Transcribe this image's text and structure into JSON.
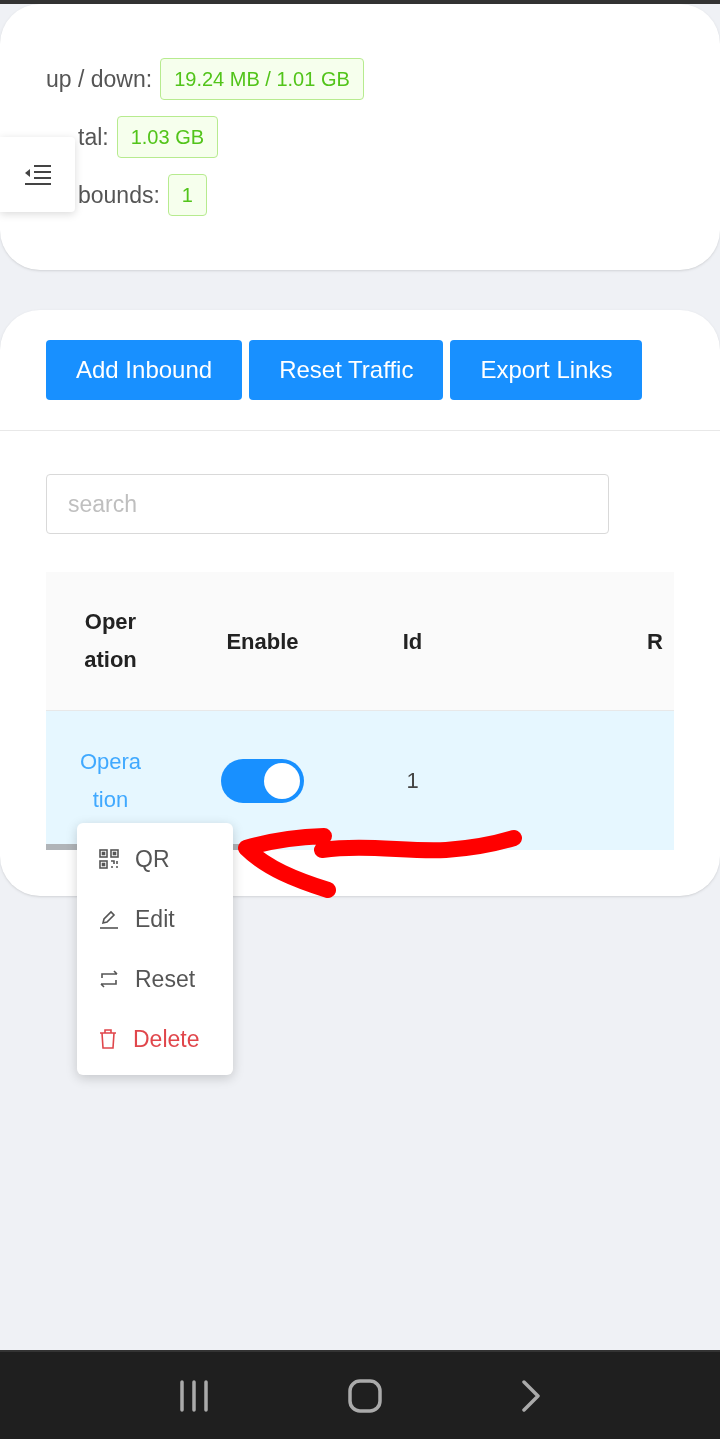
{
  "stats": [
    {
      "label": "up / down:",
      "value": "19.24 MB / 1.01 GB"
    },
    {
      "label": "tal:",
      "value": "1.03 GB"
    },
    {
      "label": "bounds:",
      "value": "1"
    }
  ],
  "buttons": [
    "Add Inbound",
    "Reset Traffic",
    "Export Links"
  ],
  "search": {
    "placeholder": "search"
  },
  "table": {
    "columns": [
      "Operation",
      "Enable",
      "Id",
      "R"
    ],
    "rows": [
      {
        "operation": "Operation",
        "enable": true,
        "id": "1",
        "selected": true
      }
    ]
  },
  "menu": [
    {
      "label": "QR",
      "kind": "qr"
    },
    {
      "label": "Edit",
      "kind": "edit"
    },
    {
      "label": "Reset",
      "kind": "reset"
    },
    {
      "label": "Delete",
      "kind": "delete"
    }
  ]
}
